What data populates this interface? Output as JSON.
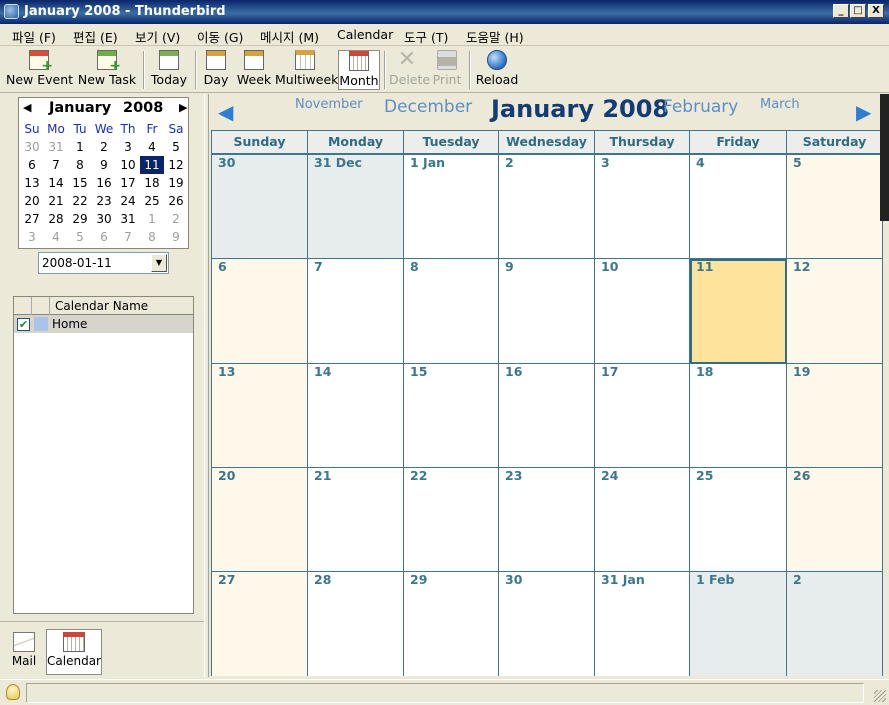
{
  "window": {
    "title": "January 2008 - Thunderbird",
    "min": "_",
    "max": "□",
    "close": "X"
  },
  "menu": [
    "파일 (F)",
    "편집 (E)",
    "보기 (V)",
    "이동 (G)",
    "메시지 (M)",
    "Calendar",
    "도구 (T)",
    "도움말 (H)"
  ],
  "toolbar": {
    "new_event": "New Event",
    "new_task": "New Task",
    "today": "Today",
    "day": "Day",
    "week": "Week",
    "multiweek": "Multiweek",
    "month": "Month",
    "delete": "Delete",
    "print": "Print",
    "reload": "Reload"
  },
  "minical": {
    "month": "January",
    "year": "2008",
    "prev": "◀",
    "next": "▶",
    "dows": [
      "Su",
      "Mo",
      "Tu",
      "We",
      "Th",
      "Fr",
      "Sa"
    ],
    "days": [
      "30",
      "31",
      "1",
      "2",
      "3",
      "4",
      "5",
      "6",
      "7",
      "8",
      "9",
      "10",
      "11",
      "12",
      "13",
      "14",
      "15",
      "16",
      "17",
      "18",
      "19",
      "20",
      "21",
      "22",
      "23",
      "24",
      "25",
      "26",
      "27",
      "28",
      "29",
      "30",
      "31",
      "1",
      "2",
      "3",
      "4",
      "5",
      "6",
      "7",
      "8",
      "9"
    ],
    "other_month": [
      0,
      1,
      33,
      34,
      35,
      36,
      37,
      38,
      39,
      40,
      41
    ],
    "selected": 12
  },
  "date_picker": {
    "value": "2008-01-11",
    "arrow": "▼"
  },
  "calendar_list": {
    "header": "Calendar Name",
    "items": [
      {
        "name": "Home",
        "checked": "✔",
        "color": "#a9c4e8"
      }
    ]
  },
  "modes": {
    "mail": "Mail",
    "calendar": "Calendar"
  },
  "month_nav": {
    "prev2": "November",
    "prev1": "December",
    "current": "January 2008",
    "next1": "February",
    "next2": "March",
    "prev_arrow": "◀",
    "next_arrow": "▶"
  },
  "month_view": {
    "dows": [
      "Sunday",
      "Monday",
      "Tuesday",
      "Wednesday",
      "Thursday",
      "Friday",
      "Saturday"
    ],
    "cells": [
      "30",
      "31 Dec",
      "1 Jan",
      "2",
      "3",
      "4",
      "5",
      "6",
      "7",
      "8",
      "9",
      "10",
      "11",
      "12",
      "13",
      "14",
      "15",
      "16",
      "17",
      "18",
      "19",
      "20",
      "21",
      "22",
      "23",
      "24",
      "25",
      "26",
      "27",
      "28",
      "29",
      "30",
      "31 Jan",
      "1 Feb",
      "2"
    ],
    "other_month": [
      0,
      1,
      33,
      34
    ],
    "today_index": 12,
    "colors": {
      "other": "#e7ecec",
      "weekend": "#fdf8e9",
      "weekday": "#ffffff",
      "today": "#fde39c"
    }
  }
}
